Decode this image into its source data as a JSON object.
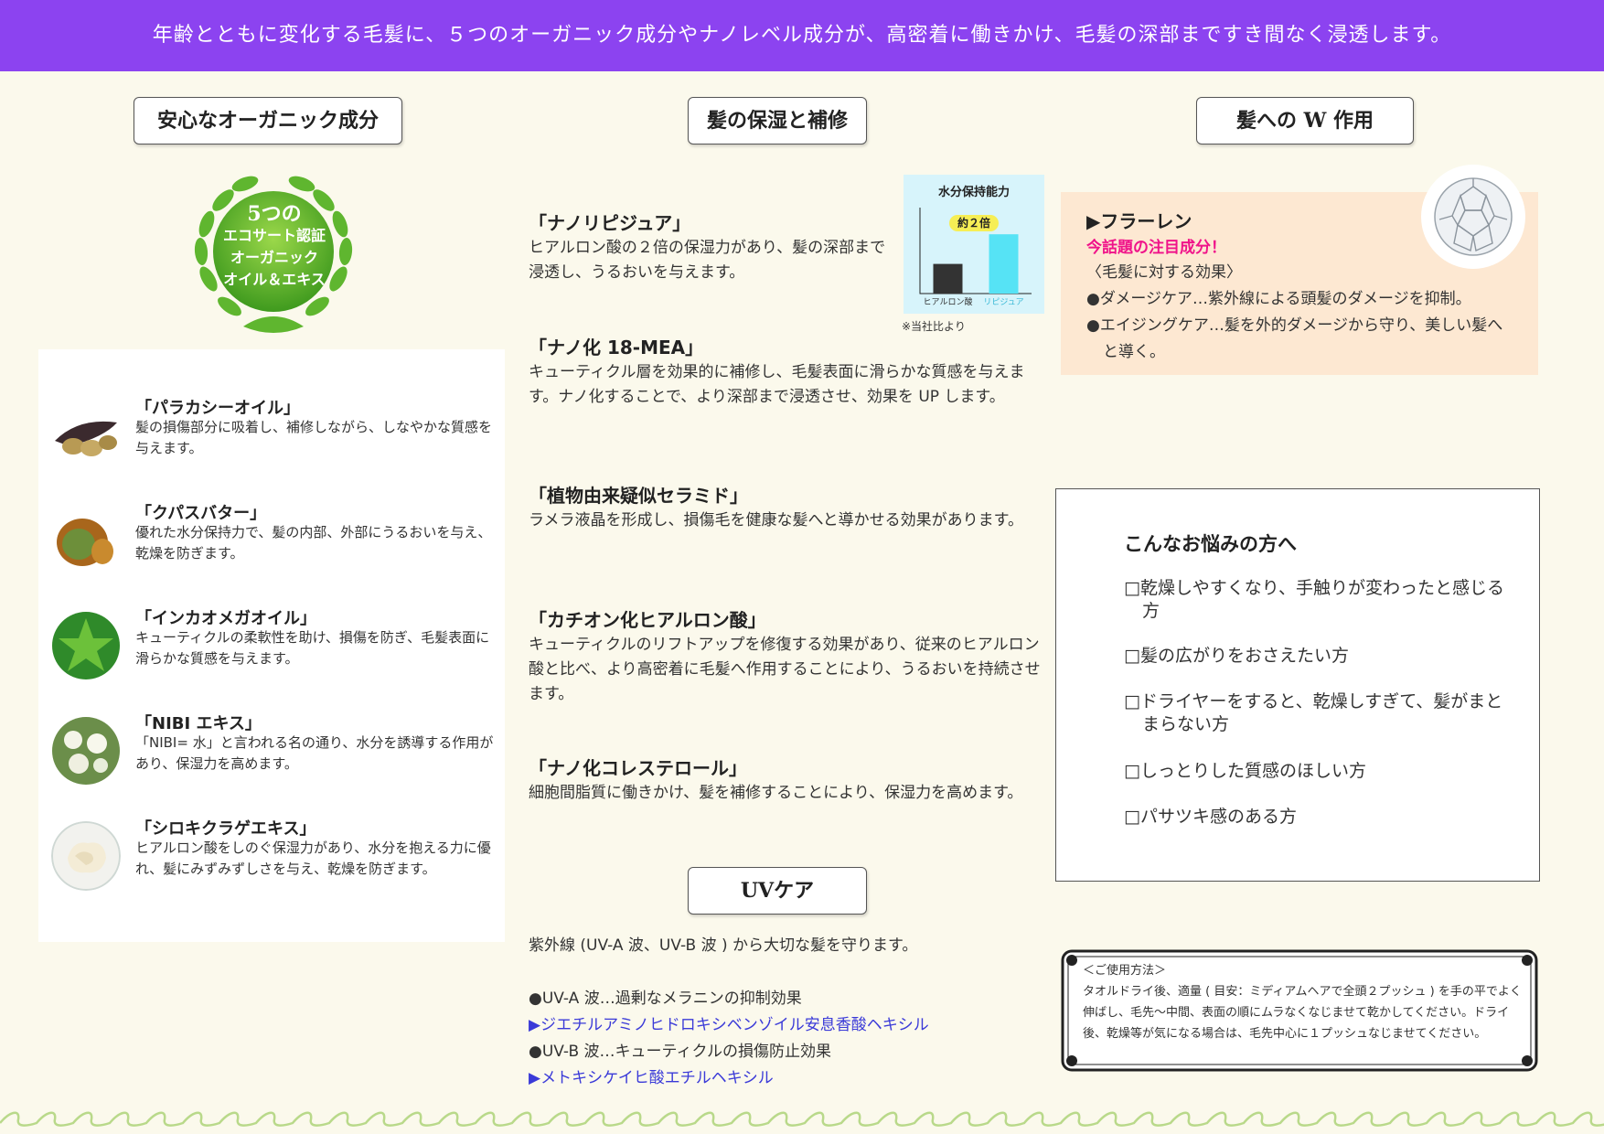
{
  "banner": "年齢とともに変化する毛髪に、５つのオーガニック成分やナノレベル成分が、高密着に働きかけ、毛髪の深部まですき間なく浸透します。",
  "sections": {
    "organic": "安心なオーガニック成分",
    "moisture": "髪の保湿と補修",
    "wdouble": "髪への W 作用",
    "uv": "UVケア"
  },
  "badge": {
    "line1": "5つの",
    "line2": "エコサート認証",
    "line3": "オーガニック",
    "line4": "オイル＆エキス"
  },
  "organic_items": [
    {
      "name": "「パラカシーオイル」",
      "desc": "髪の損傷部分に吸着し、補修しながら、しなやかな質感を与えます。"
    },
    {
      "name": "「クパスバター」",
      "desc": "優れた水分保持力で、髪の内部、外部にうるおいを与え、乾燥を防ぎます。"
    },
    {
      "name": "「インカオメガオイル」",
      "desc": "キューティクルの柔軟性を助け、損傷を防ぎ、毛髪表面に滑らかな質感を与えます。"
    },
    {
      "name": "「NIBI エキス」",
      "desc": "「NIBI= 水」と言われる名の通り、水分を誘導する作用があり、保湿力を高めます。"
    },
    {
      "name": "「シロキクラゲエキス」",
      "desc": "ヒアルロン酸をしのぐ保湿力があり、水分を抱える力に優れ、髪にみずみずしさを与え、乾燥を防ぎます。"
    }
  ],
  "moisture_items": [
    {
      "name": "「ナノリピジュア」",
      "desc": "ヒアルロン酸の２倍の保湿力があり、髪の深部まで浸透し、うるおいを与えます。"
    },
    {
      "name": "「ナノ化 18-MEA」",
      "desc": "キューティクル層を効果的に補修し、毛髪表面に滑らかな質感を与えます。ナノ化することで、より深部まで浸透させ、効果を UP します。"
    },
    {
      "name": "「植物由来疑似セラミド」",
      "desc": "ラメラ液晶を形成し、損傷毛を健康な髪へと導かせる効果があります。"
    },
    {
      "name": "「カチオン化ヒアルロン酸」",
      "desc": "キューティクルのリフトアップを修復する効果があり、従来のヒアルロン酸と比べ、より高密着に毛髪へ作用することにより、うるおいを持続させます。"
    },
    {
      "name": "「ナノ化コレステロール」",
      "desc": "細胞間脂質に働きかけ、髪を補修することにより、保湿力を高めます。"
    }
  ],
  "chart_data": {
    "type": "bar",
    "title": "水分保持能力",
    "categories": [
      "ヒアルロン酸",
      "リピジュア"
    ],
    "values": [
      1,
      2
    ],
    "annotation": "約２倍",
    "note": "※当社比より",
    "colors": [
      "#333333",
      "#56e3f5"
    ]
  },
  "uv": {
    "intro": "紫外線 (UV-A 波、UV-B 波 ) から大切な髪を守ります。",
    "a_effect": "●UV-A 波…過剰なメラニンの抑制効果",
    "a_ingredient": "▶ジエチルアミノヒドロキシベンゾイル安息香酸ヘキシル",
    "b_effect": "●UV-B 波…キューティクルの損傷防止効果",
    "b_ingredient": "▶メトキシケイヒ酸エチルヘキシル"
  },
  "fullerene": {
    "title": "▶フラーレン",
    "highlight": "今話題の注目成分！",
    "subhead": "〈毛髪に対する効果〉",
    "point1": "●ダメージケア…紫外線による頭髪のダメージを抑制。",
    "point2": "●エイジングケア…髪を外的ダメージから守り、美しい髪へと導く。"
  },
  "worries": {
    "title": "こんなお悩みの方へ",
    "items": [
      "□乾燥しやすくなり、手触りが変わったと感じる方",
      "□髪の広がりをおさえたい方",
      "□ドライヤーをすると、乾燥しすぎて、髪がまとまらない方",
      "□しっとりした質感のほしい方",
      "□パサツキ感のある方"
    ]
  },
  "usage": {
    "title": "＜ご使用方法＞",
    "text": "タオルドライ後、適量 ( 目安：ミディアムヘアで全頭２プッシュ ) を手の平でよく伸ばし、毛先～中間、表面の順にムラなくなじませて乾かしてください。ドライ後、乾燥等が気になる場合は、毛先中心に１プッシュなじませてください。"
  },
  "colors": {
    "banner": "#8c43f0",
    "background": "#fbf9ec",
    "highlight_pink": "#f0138a",
    "uv_blue": "#3a3ad8",
    "fullerene_panel": "#fde8d2",
    "chart_panel": "#d7f4fb"
  }
}
